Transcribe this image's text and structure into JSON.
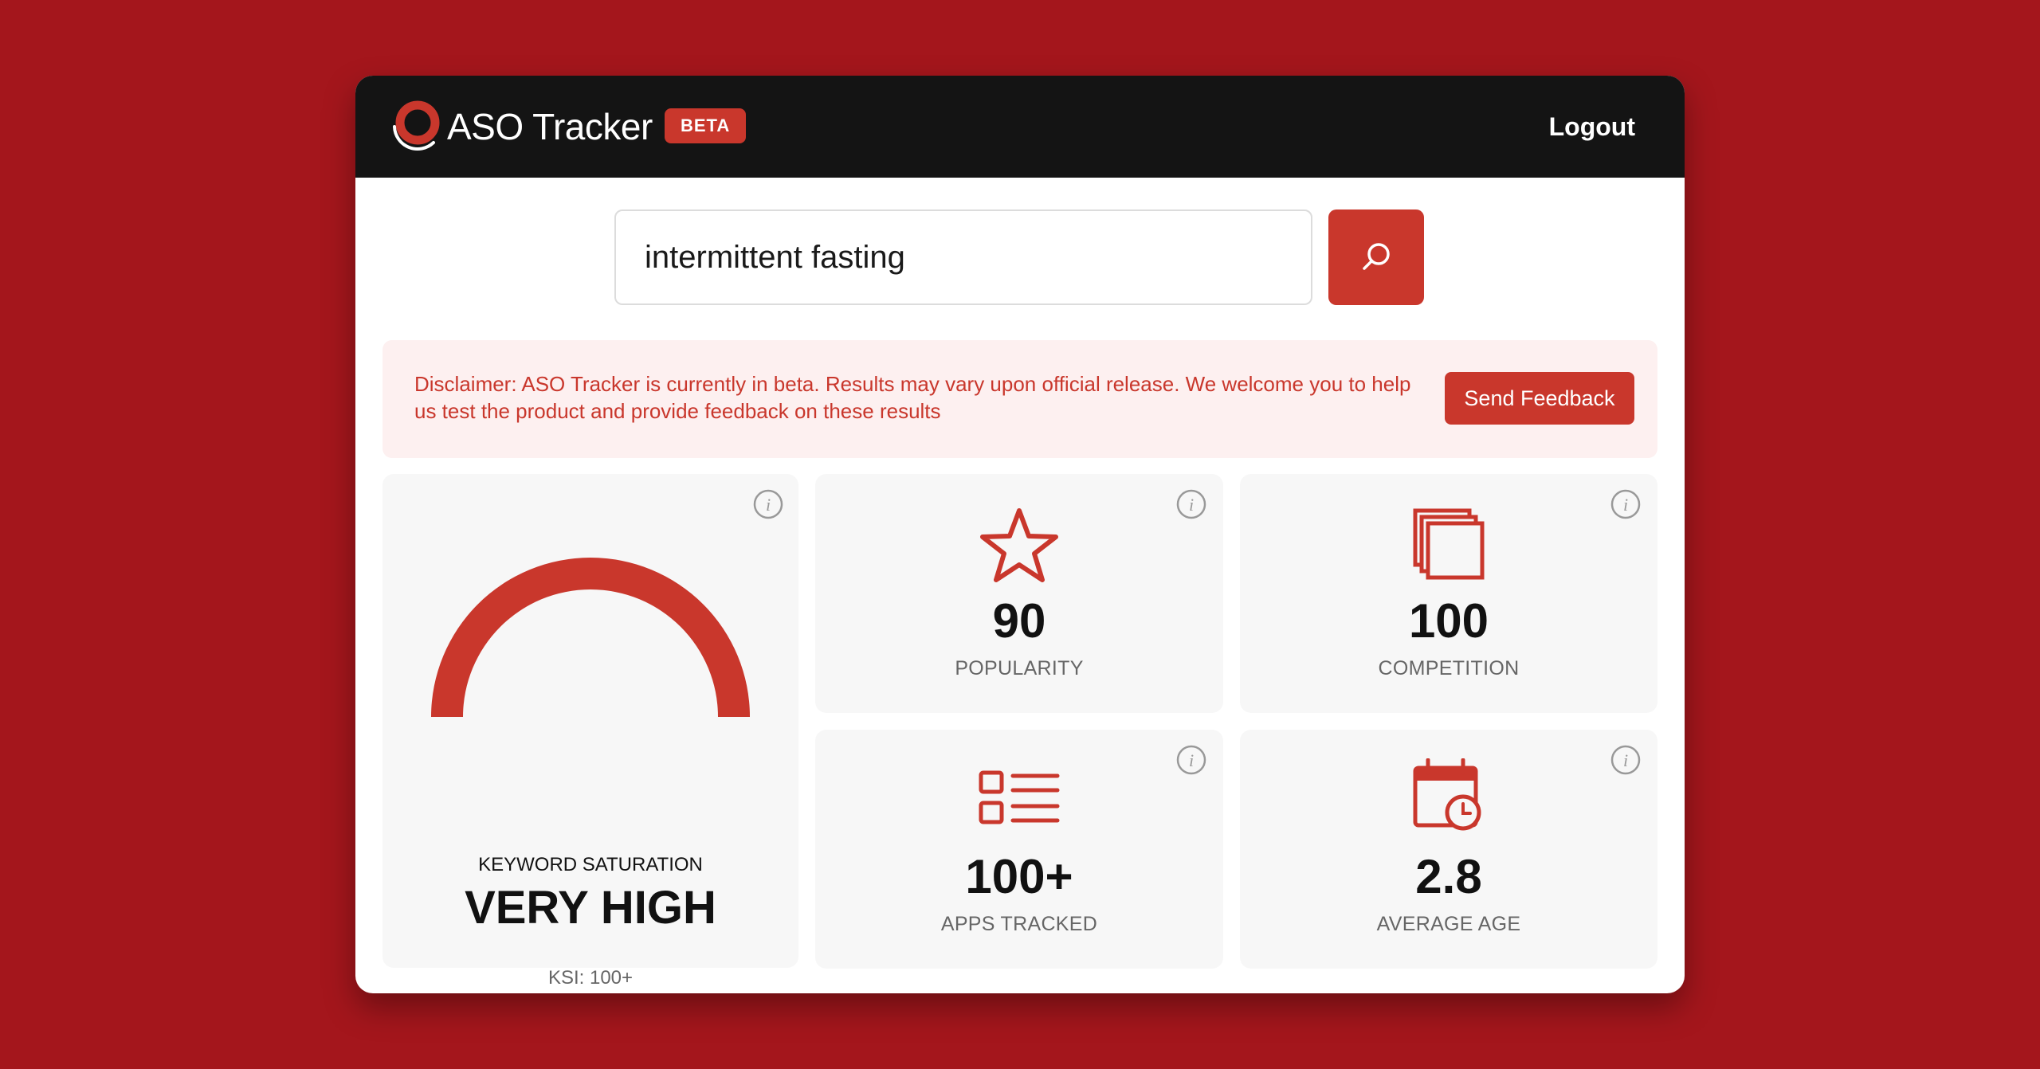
{
  "header": {
    "brand": "ASO Tracker",
    "badge": "BETA",
    "logout": "Logout"
  },
  "search": {
    "value": "intermittent fasting"
  },
  "disclaimer": {
    "text": "Disclaimer: ASO Tracker is currently in beta. Results may vary upon official release. We welcome you to help us test the product and provide feedback on these results",
    "button": "Send Feedback"
  },
  "saturation": {
    "label": "KEYWORD SATURATION",
    "value": "VERY HIGH",
    "ksi": "KSI: 100+",
    "gauge_fraction": 1.0
  },
  "metrics": {
    "popularity": {
      "value": "90",
      "label": "POPULARITY",
      "icon": "star-icon"
    },
    "competition": {
      "value": "100",
      "label": "COMPETITION",
      "icon": "stacked-squares-icon"
    },
    "apps_tracked": {
      "value": "100+",
      "label": "APPS TRACKED",
      "icon": "list-icon"
    },
    "average_age": {
      "value": "2.8",
      "label": "AVERAGE AGE",
      "icon": "calendar-clock-icon"
    }
  },
  "colors": {
    "accent": "#c9372c",
    "background": "#a4161c",
    "header": "#141414",
    "card": "#f7f7f7"
  }
}
